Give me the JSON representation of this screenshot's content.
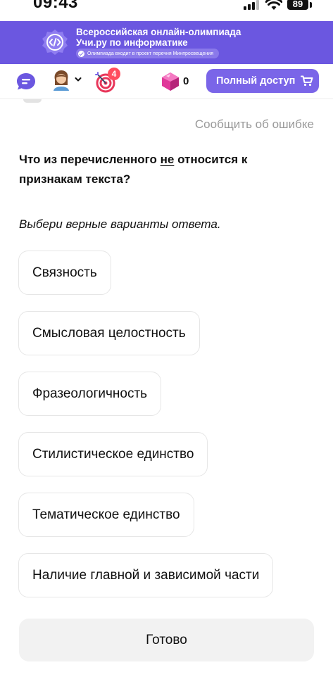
{
  "status_bar": {
    "time": "09:43",
    "battery": "89"
  },
  "banner": {
    "title_line1": "Всероссийская онлайн-олимпиада",
    "title_line2": "Учи.ру по информатике",
    "pill_text": "Олимпиада входит в проект перечня Минпросвещения",
    "logo_icon": "code-brackets-icon"
  },
  "navbar": {
    "notifications_count": "4",
    "gems_count": "0",
    "full_access_label": "Полный доступ"
  },
  "report_error_label": "Сообщить об ошибке",
  "question": {
    "before": "Что из перечисленного ",
    "emphasis": "не",
    "after": " относится к признакам текста?"
  },
  "instruction": "Выбери верные варианты ответа.",
  "options": [
    "Связность",
    "Смысловая целостность",
    "Фразеологичность",
    "Стилистическое единство",
    "Тематическое единство",
    "Наличие главной и зависимой части"
  ],
  "done_label": "Готово",
  "colors": {
    "brand_purple": "#6b57e0",
    "button_purple": "#7a65e8",
    "badge_red": "#ff4d5e",
    "gem_pink": "#e0399a"
  }
}
